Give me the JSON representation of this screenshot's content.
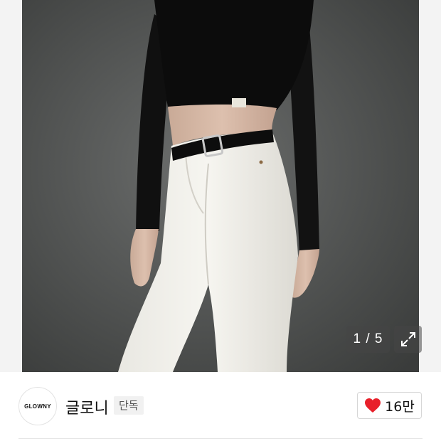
{
  "gallery": {
    "counter": "1 / 5",
    "expand_icon": "expand-icon"
  },
  "brand": {
    "logo_text": "GLOWNY",
    "name": "글로니",
    "badge": "단독"
  },
  "like": {
    "icon": "heart-icon",
    "count": "16만",
    "heart_color": "#e8202a"
  }
}
